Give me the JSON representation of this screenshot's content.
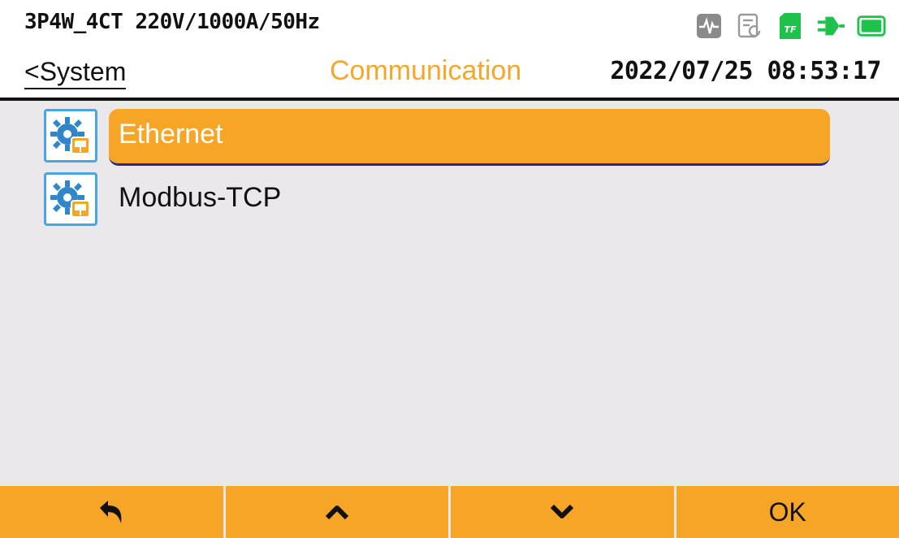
{
  "header": {
    "config": "3P4W_4CT 220V/1000A/50Hz",
    "back_label": "<System",
    "title": "Communication",
    "datetime": "2022/07/25 08:53:17",
    "status_icons": [
      "waveform-icon",
      "record-icon",
      "tf-card-icon",
      "power-plug-icon",
      "battery-icon"
    ],
    "tf_label": "TF"
  },
  "menu": {
    "items": [
      {
        "label": "Ethernet",
        "icon": "gear-network-icon",
        "selected": true
      },
      {
        "label": "Modbus-TCP",
        "icon": "gear-network-icon",
        "selected": false
      }
    ]
  },
  "footer": {
    "buttons": [
      {
        "icon": "return-icon"
      },
      {
        "icon": "chevron-up-icon"
      },
      {
        "icon": "chevron-down-icon"
      },
      {
        "label": "OK"
      }
    ]
  },
  "colors": {
    "accent": "#f6a527",
    "title": "#f4a72d",
    "icon_blue": "#4aa6e0",
    "status_green": "#1ec24a",
    "background": "#ebe8eb"
  }
}
